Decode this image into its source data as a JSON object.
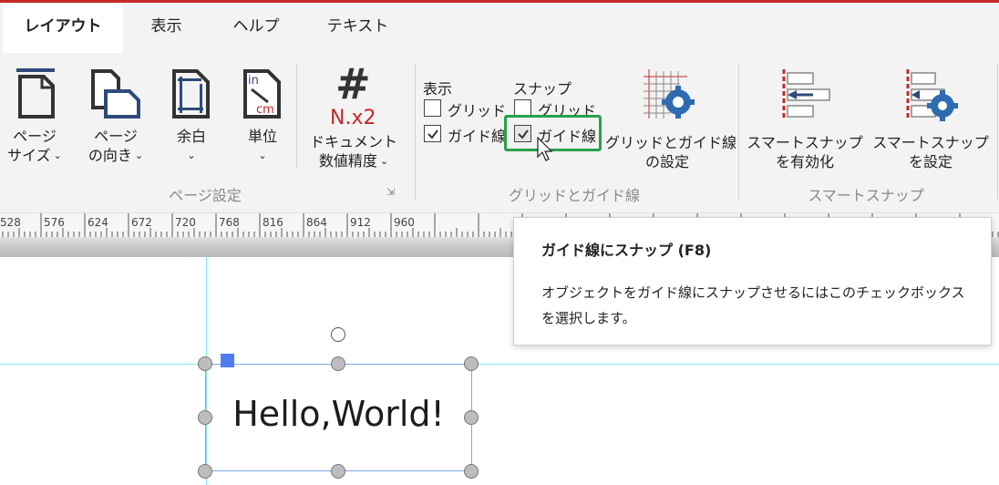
{
  "tabs": [
    "レイアウト",
    "表示",
    "ヘルプ",
    "テキスト"
  ],
  "ribbon": {
    "page_setup": {
      "page_size": [
        "ページ",
        "サイズ"
      ],
      "orientation": [
        "ページ",
        "の向き"
      ],
      "margins": "余白",
      "units": "単位",
      "doc_precision": [
        "ドキュメント",
        "数値精度"
      ],
      "precision_icon_text": "N.x2",
      "units_icon_top": "in",
      "units_icon_bottom": "cm",
      "group_label": "ページ設定"
    },
    "grid_guides": {
      "show_header": "表示",
      "snap_header": "スナップ",
      "show_grid": "グリッド",
      "show_guides": "ガイド線",
      "snap_grid": "グリッド",
      "snap_guides": "ガイド線",
      "show_grid_checked": false,
      "show_guides_checked": true,
      "snap_grid_checked": false,
      "snap_guides_checked": true,
      "settings_label": [
        "グリッドとガイド線",
        "の設定"
      ],
      "group_label": "グリッドとガイド線"
    },
    "smart_snap": {
      "enable_label": [
        "スマートスナップ",
        "を有効化"
      ],
      "settings_label": [
        "スマートスナップ",
        "を設定"
      ],
      "group_label": "スマートスナップ"
    }
  },
  "ruler": {
    "labels": [
      "528",
      "576",
      "624",
      "672",
      "720",
      "768",
      "816",
      "864",
      "912",
      "960"
    ]
  },
  "canvas": {
    "text": "Hello,World!"
  },
  "tooltip": {
    "title": "ガイド線にスナップ (F8)",
    "body": "オブジェクトをガイド線にスナップさせるにはこのチェックボックスを選択します。"
  },
  "colors": {
    "accent_red": "#c62828",
    "highlight_green": "#27a14a",
    "guide_cyan": "#7ee8f0",
    "selection_blue": "#4f7df0",
    "icon_navy": "#2e4a7a"
  }
}
